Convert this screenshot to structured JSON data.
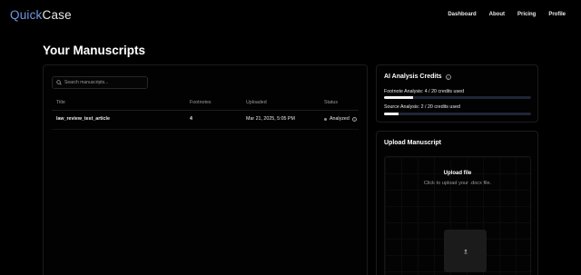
{
  "app": {
    "logo_part1": "Quick",
    "logo_part2": "Case",
    "accent_color": "#6f98e2"
  },
  "nav": {
    "items": [
      "Dashboard",
      "About",
      "Pricing",
      "Profile"
    ]
  },
  "page": {
    "title": "Your Manuscripts"
  },
  "search": {
    "placeholder": "Search manuscripts...",
    "value": "",
    "icon": "search-icon"
  },
  "table": {
    "columns": [
      "Title",
      "Footnotes",
      "Uploaded",
      "Status"
    ],
    "rows": [
      {
        "title": "law_review_test_article",
        "footnotes": "4",
        "uploaded": "Mar 21, 2025, 5:05 PM",
        "status": "Analyzed",
        "status_icon": "info-icon"
      }
    ]
  },
  "credits": {
    "title": "AI Analysis Credits",
    "footnote_label": "Footnote Analysis: 4 / 20 credits used",
    "footnote_fraction": 0.2,
    "source_label": "Source Analysis: 2 / 20 credits used",
    "source_fraction": 0.1
  },
  "upload": {
    "title": "Upload Manuscript",
    "dropzone_title": "Upload file",
    "dropzone_subtitle": "Click to upload your .docx file.",
    "button_icon": "upload-icon"
  }
}
